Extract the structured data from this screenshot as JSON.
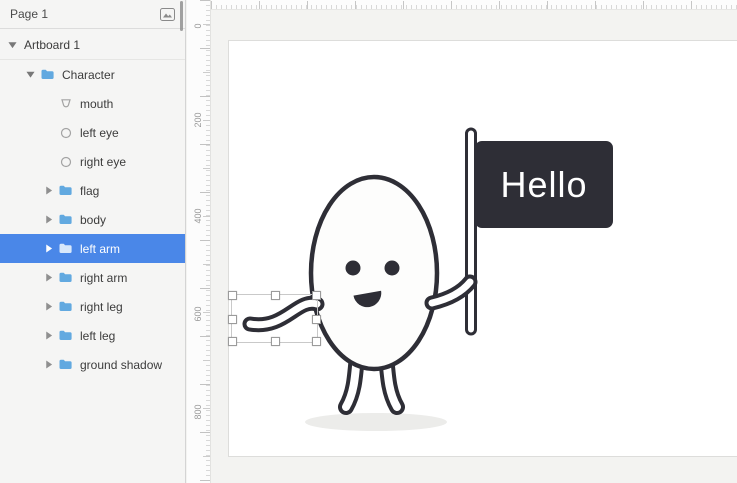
{
  "sidebar": {
    "header": {
      "title": "Page 1"
    },
    "layers": [
      {
        "label": "Artboard 1",
        "kind": "artboard",
        "disclosure": "down",
        "selected": false
      },
      {
        "label": "Character",
        "kind": "group",
        "disclosure": "down",
        "selected": false
      },
      {
        "label": "mouth",
        "kind": "shape",
        "disclosure": "none",
        "selected": false
      },
      {
        "label": "left eye",
        "kind": "oval",
        "disclosure": "none",
        "selected": false
      },
      {
        "label": "right eye",
        "kind": "oval",
        "disclosure": "none",
        "selected": false
      },
      {
        "label": "flag",
        "kind": "group",
        "disclosure": "right",
        "selected": false
      },
      {
        "label": "body",
        "kind": "group",
        "disclosure": "right",
        "selected": false
      },
      {
        "label": "left arm",
        "kind": "group",
        "disclosure": "right",
        "selected": true
      },
      {
        "label": "right arm",
        "kind": "group",
        "disclosure": "right",
        "selected": false
      },
      {
        "label": "right leg",
        "kind": "group",
        "disclosure": "right",
        "selected": false
      },
      {
        "label": "left leg",
        "kind": "group",
        "disclosure": "right",
        "selected": false
      },
      {
        "label": "ground shadow",
        "kind": "group",
        "disclosure": "right",
        "selected": false
      }
    ]
  },
  "ruler": {
    "labels": [
      "0",
      "200",
      "400",
      "600",
      "800"
    ]
  },
  "canvas": {
    "flag_text": "Hello"
  },
  "icons": {
    "page_list_icon": "framed-image",
    "disclosure_down": "▾",
    "disclosure_right": "▸",
    "folder_icon": "folder",
    "oval_icon": "circle-outline",
    "shape_icon": "path-outline"
  },
  "colors": {
    "selection_blue": "#4a87e8",
    "folder_blue": "#62a9e0",
    "ink": "#2e2e36",
    "flag_bg": "#2e2e36",
    "artboard_bg": "#ffffff"
  }
}
